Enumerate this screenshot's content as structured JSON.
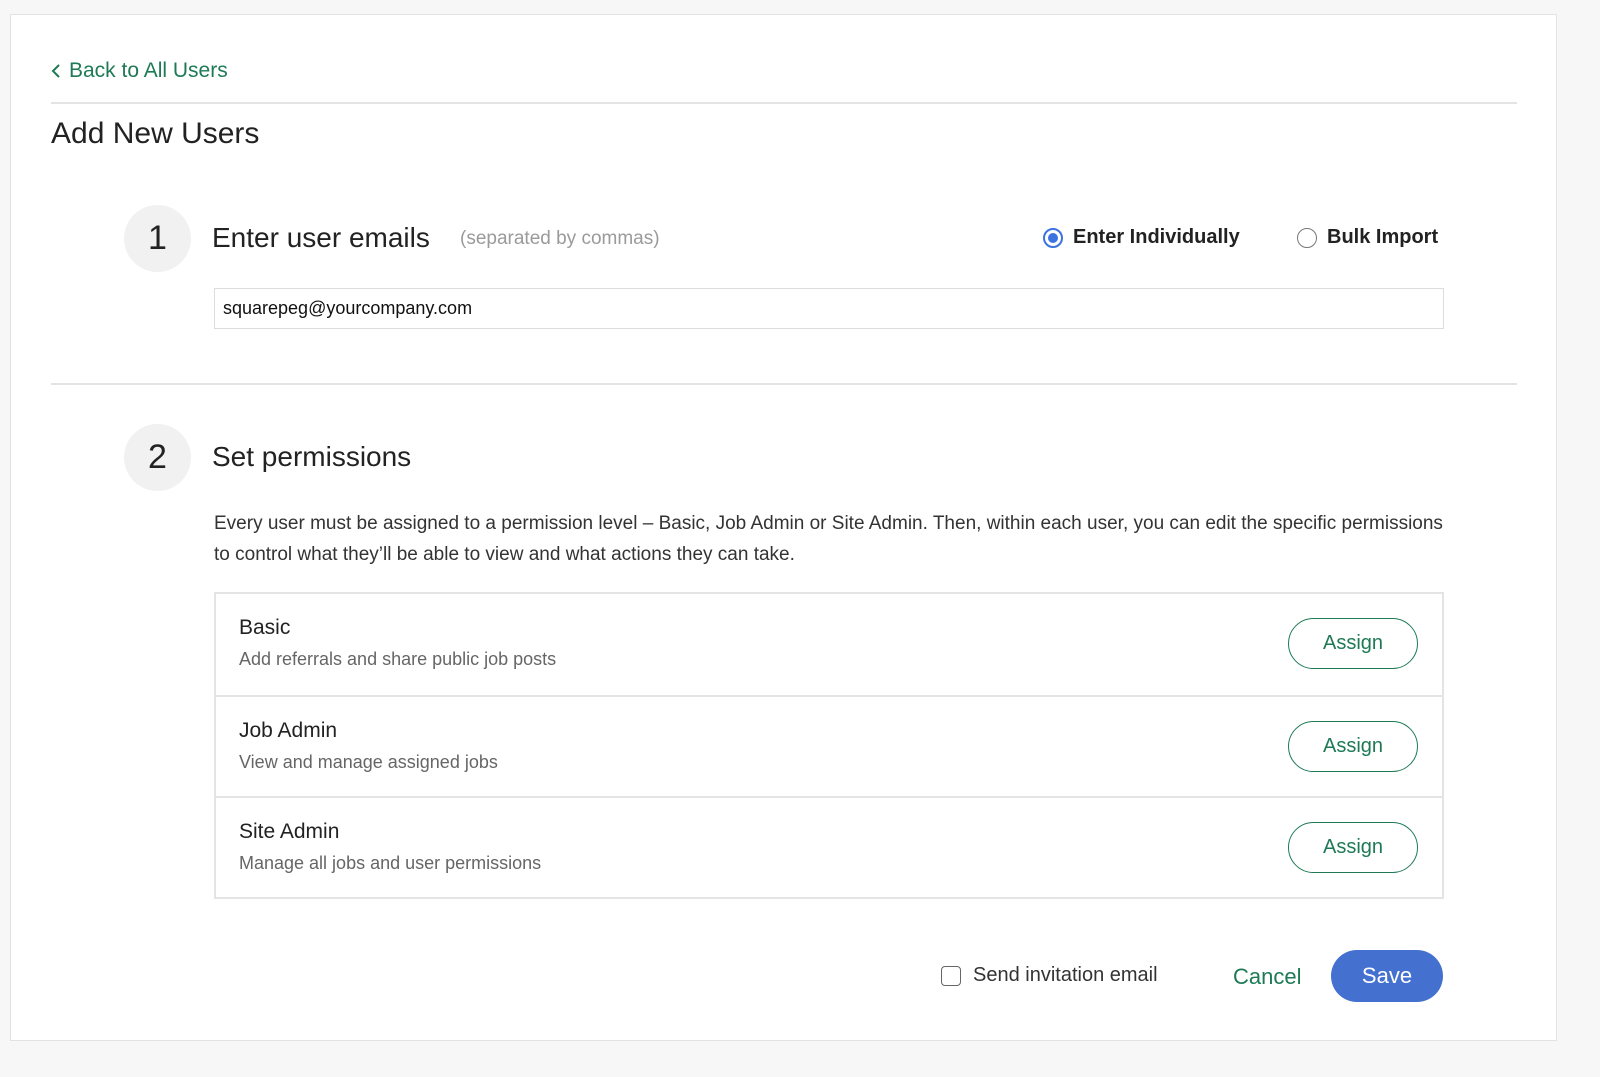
{
  "nav": {
    "back_label": "Back to All Users"
  },
  "page": {
    "title": "Add New Users"
  },
  "step1": {
    "number": "1",
    "heading": "Enter user emails",
    "hint": "(separated by commas)",
    "options": [
      {
        "label": "Enter Individually",
        "selected": true
      },
      {
        "label": "Bulk Import",
        "selected": false
      }
    ],
    "email_value": "squarepeg@yourcompany.com"
  },
  "step2": {
    "number": "2",
    "heading": "Set permissions",
    "description": "Every user must be assigned to a permission level – Basic, Job Admin or Site Admin. Then, within each user, you can edit the specific permissions to control what they’ll be able to view and what actions they can take.",
    "levels": [
      {
        "name": "Basic",
        "description": "Add referrals and share public job posts",
        "action": "Assign"
      },
      {
        "name": "Job Admin",
        "description": "View and manage assigned jobs",
        "action": "Assign"
      },
      {
        "name": "Site Admin",
        "description": "Manage all jobs and user permissions",
        "action": "Assign"
      }
    ]
  },
  "footer": {
    "send_invite_label": "Send invitation email",
    "send_invite_checked": false,
    "cancel_label": "Cancel",
    "save_label": "Save"
  },
  "colors": {
    "accent_green": "#1e7a55",
    "primary_blue": "#4470d0"
  }
}
